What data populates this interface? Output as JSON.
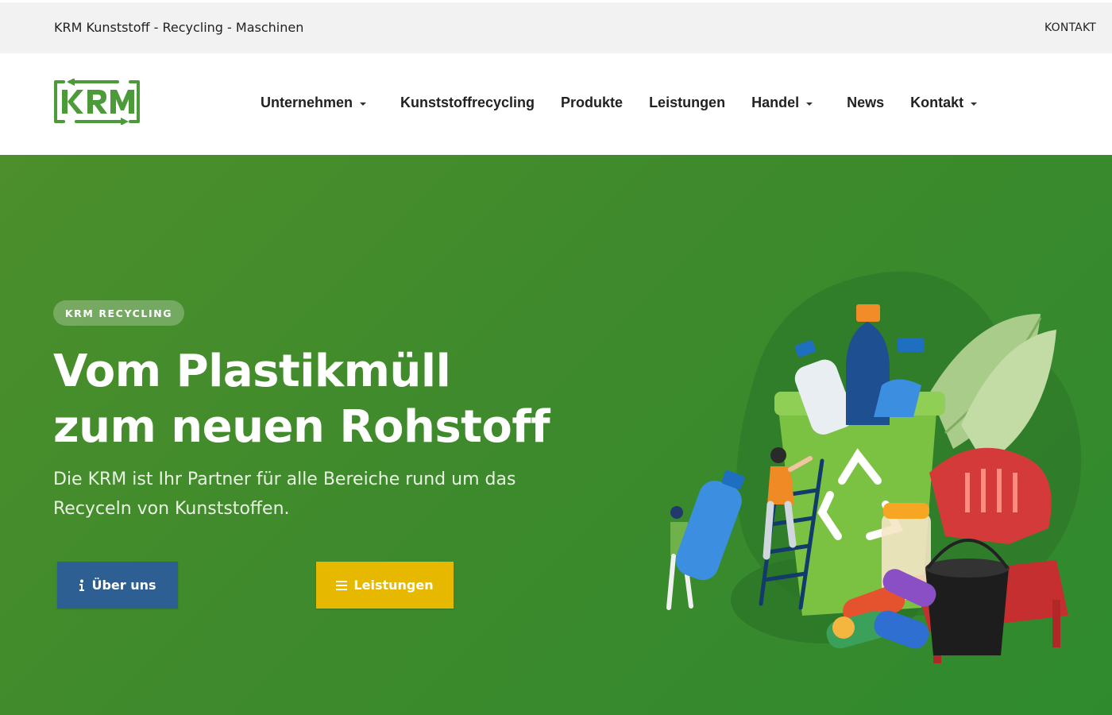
{
  "topbar": {
    "title": "KRM Kunststoff - Recycling - Maschinen",
    "contact_link": "KONTAKT"
  },
  "header": {
    "logo_text": "KRM",
    "nav": [
      {
        "label": "Unternehmen",
        "dropdown": true
      },
      {
        "label": "Kunststoffrecycling",
        "dropdown": false
      },
      {
        "label": "Produkte",
        "dropdown": false
      },
      {
        "label": "Leistungen",
        "dropdown": false
      },
      {
        "label": "Handel",
        "dropdown": true
      },
      {
        "label": "News",
        "dropdown": false
      },
      {
        "label": "Kontakt",
        "dropdown": true
      }
    ]
  },
  "hero": {
    "badge": "KRM RECYCLING",
    "title": "Vom Plastikmüll zum neuen Rohstoff",
    "text": "Die KRM ist Ihr Partner für alle Bereiche rund um das Recyceln von Kunststoffen.",
    "buttons": {
      "about": {
        "label": "Über uns",
        "icon": "info-icon"
      },
      "services": {
        "label": "Leistungen",
        "icon": "menu-lines-icon"
      }
    }
  },
  "colors": {
    "hero_green": "#3e8a2c",
    "brand_green": "#4c9a3a",
    "button_blue": "#2d5f93",
    "button_yellow": "#e6b800"
  }
}
